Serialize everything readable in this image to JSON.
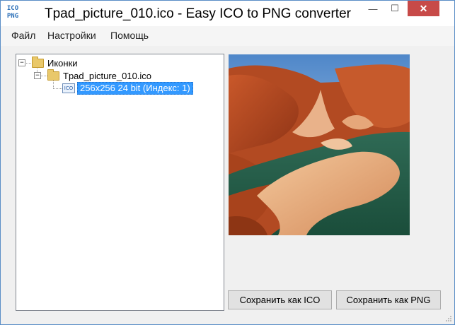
{
  "window": {
    "title": "Tpad_picture_010.ico - Easy ICO to PNG converter",
    "app_icon_line1": "ICO",
    "app_icon_line2": "PNG",
    "minimize_glyph": "—",
    "maximize_glyph": "☐",
    "close_glyph": "✕"
  },
  "menu": {
    "items": [
      "Файл",
      "Настройки",
      "Помощь"
    ]
  },
  "tree": {
    "root": {
      "label": "Иконки",
      "expander": "−"
    },
    "file": {
      "label": "Tpad_picture_010.ico",
      "expander": "−"
    },
    "entry": {
      "label": "256x256 24 bit (Индекс: 1)",
      "badge": "ICO"
    }
  },
  "buttons": {
    "save_ico": "Сохранить как ICO",
    "save_png": "Сохранить как PNG"
  },
  "colors": {
    "selection": "#3399ff",
    "close_button": "#c74a48",
    "window_border": "#5a8ec6"
  }
}
